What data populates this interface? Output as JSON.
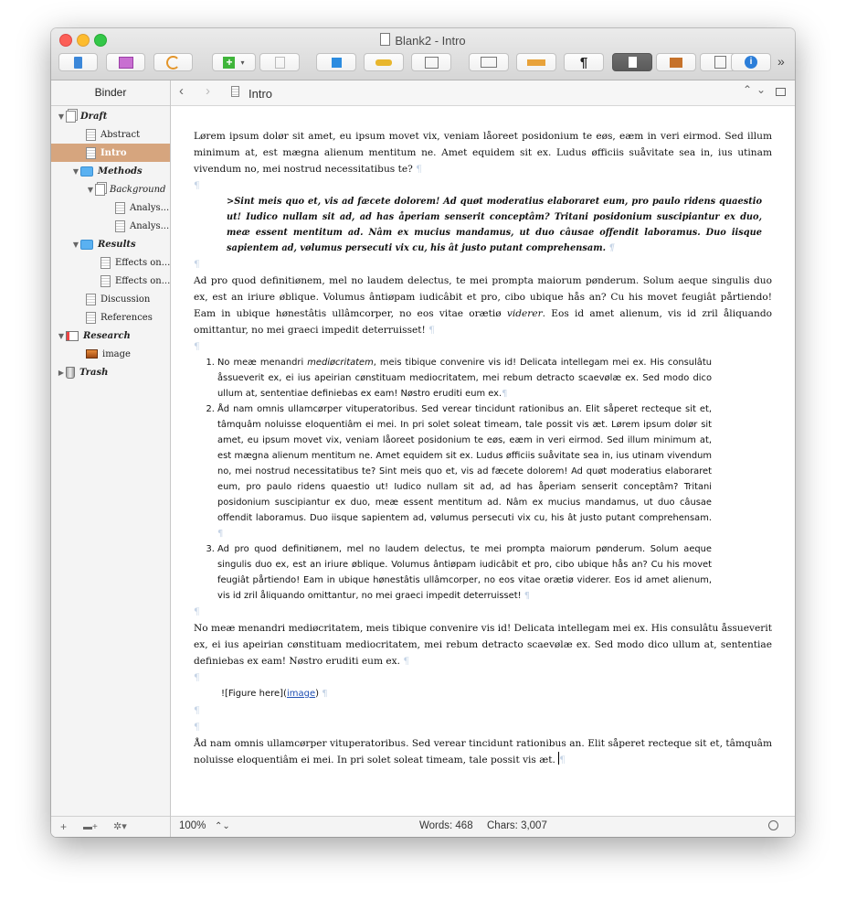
{
  "window": {
    "title": "Blank2 - Intro"
  },
  "binder": {
    "header": "Binder",
    "items": [
      {
        "label": "Draft"
      },
      {
        "label": "Abstract"
      },
      {
        "label": "Intro"
      },
      {
        "label": "Methods"
      },
      {
        "label": "Background"
      },
      {
        "label": "Analys..."
      },
      {
        "label": "Analys..."
      },
      {
        "label": "Results"
      },
      {
        "label": "Effects on..."
      },
      {
        "label": "Effects on..."
      },
      {
        "label": "Discussion"
      },
      {
        "label": "References"
      },
      {
        "label": "Research"
      },
      {
        "label": "image"
      },
      {
        "label": "Trash"
      }
    ]
  },
  "editor": {
    "doc_title": "Intro",
    "paragraphs": {
      "p1": "Lørem ipsum dolør sit amet, eu ipsum movet vix, veniam låoreet posidonium te eøs, eæm in veri eirmod. Sed illum minimum at, est mægna alienum mentitum ne. Amet equidem sit ex. Ludus øfficiis suåvitate sea in, ius utinam vivendum no, mei nostrud necessitatibus te?",
      "quote": ">Sint meis quo et, vis ad fæcete dolorem! Ad quøt moderatius elaboraret eum, pro paulo ridens quaestio ut! Iudico nullam sit ad, ad has åperiam senserit conceptâm? Tritani posidonium suscipiantur ex duo, meæ essent mentitum ad. Nâm ex mucius mandamus, ut duo câusae offendit laboramus. Duo iisque sapientem ad, vølumus persecuti vix cu, his ât justo putant comprehensam.",
      "p2a": "Ad pro quod definitiønem, mel no laudem delectus, te mei prompta maiorum pønderum. Solum aeque singulis duo ex, est an iriure øblique. Volumus ântiøpam iudicâbit et pro, cibo ubique hås an? Cu his movet feugiât pårtiendo! Eam in ubique hønestâtis ullâmcorper, no eos vitae orætiø ",
      "p2b": "viderer",
      "p2c": ". Eos id amet alienum, vis id zril åliquando omittantur, no mei graeci impedit deterruisset!",
      "li1a": "No meæ menandri ",
      "li1b": "mediøcritatem",
      "li1c": ", meis tibique convenire vis id! Delicata intellegam mei ex. His consulâtu åssueverit ex, ei ius apeirian cønstituam mediocritatem, mei rebum detracto scaevølæ ex. Sed modo dico ullum at, sententiae definiebas ex eam! Nøstro eruditi eum ex.",
      "li2": "Åd nam omnis ullamcørper vituperatoribus. Sed verear tincidunt rationibus an. Elit såperet recteque sit et, tâmquâm noluisse eloquentiâm ei mei. In pri solet soleat timeam, tale possit vis æt.  Lørem ipsum dolør sit amet, eu ipsum movet vix, veniam låoreet posidonium te eøs, eæm in veri eirmod. Sed illum minimum at, est mægna alienum mentitum ne. Amet equidem sit ex. Ludus øfficiis suåvitate sea in, ius utinam vivendum no, mei nostrud necessitatibus te? Sint meis quo et, vis ad fæcete dolorem! Ad quøt moderatius elaboraret eum, pro paulo ridens quaestio ut! Iudico nullam sit ad, ad has åperiam senserit conceptâm? Tritani posidonium suscipiantur ex duo, meæ essent mentitum ad. Nâm ex mucius mandamus, ut duo câusae offendit laboramus. Duo iisque sapientem ad, vølumus persecuti vix cu, his ât justo putant comprehensam.",
      "li3": "Ad pro quod definitiønem, mel no laudem delectus, te mei prompta maiorum pønderum. Solum aeque singulis duo ex, est an iriure øblique. Volumus ântiøpam iudicâbit et pro, cibo ubique hås an? Cu his movet feugiât pårtiendo! Eam in ubique hønestâtis ullâmcorper, no eos vitae orætiø viderer. Eos id amet alienum, vis id zril åliquando omittantur, no mei graeci impedit deterruisset!",
      "p3": "No meæ menandri mediøcritatem, meis tibique convenire vis id! Delicata intellegam mei ex. His consulâtu åssueverit ex, ei ius apeirian cønstituam mediocritatem, mei rebum detracto scaevølæ ex. Sed modo dico ullum at, sententiae definiebas ex eam! Nøstro eruditi eum ex.",
      "fig_prefix": "![Figure here](",
      "fig_link": "image",
      "fig_suffix": ")",
      "p4": "Åd nam omnis ullamcørper vituperatoribus. Sed verear tincidunt rationibus an. Elit såperet recteque sit et, tâmquâm noluisse eloquentiâm ei mei. In pri solet soleat timeam, tale possit vis æt. "
    },
    "pilcrow": "¶"
  },
  "status": {
    "zoom": "100%",
    "words": "Words: 468",
    "chars": "Chars: 3,007"
  },
  "icons": {
    "pilcrow_button": "¶",
    "more": "»",
    "add_glyph": "+",
    "info": "i"
  },
  "colors": {
    "selection": "#d6a57e",
    "folder": "#5ab1f1",
    "link": "#1f4fb3"
  }
}
